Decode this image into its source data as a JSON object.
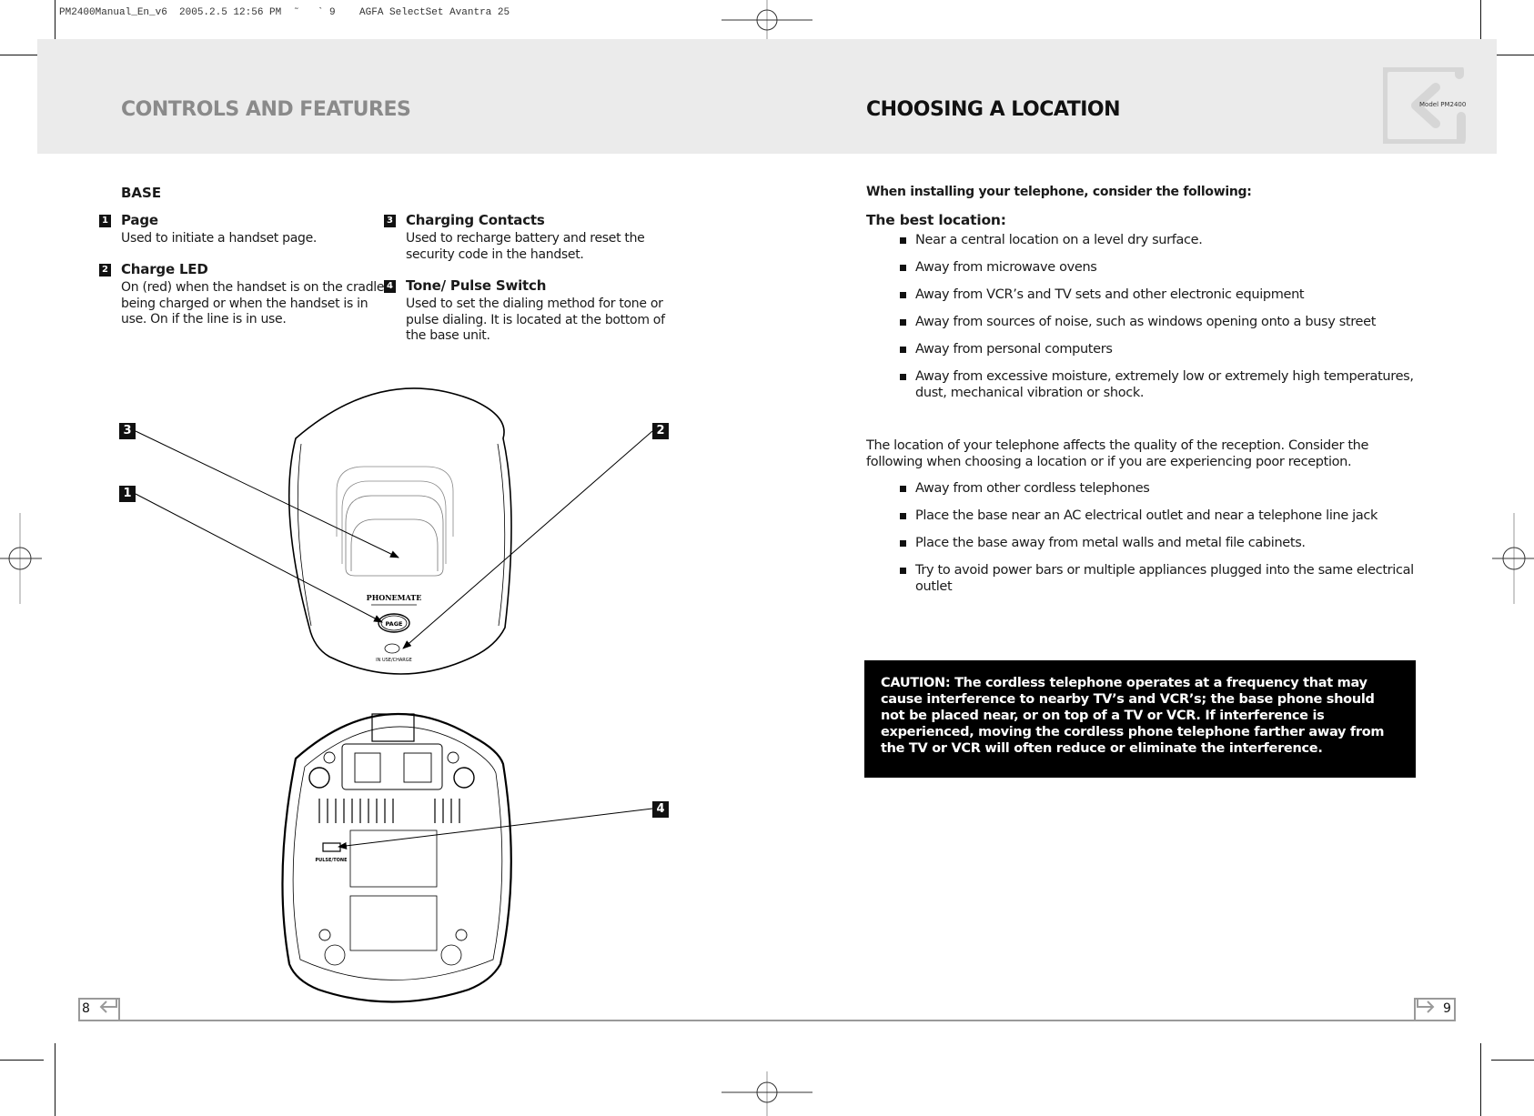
{
  "print_slug": "PM2400Manual_En_v6  2005.2.5 12:56 PM  ˜   ` 9    AGFA SelectSet Avantra 25",
  "header": {
    "left_title": "CONTROLS AND FEATURES",
    "right_title": "CHOOSING A LOCATION",
    "model_label": "Model PM2400"
  },
  "left_page": {
    "section_heading": "BASE",
    "features": [
      {
        "number": "1",
        "title": "Page",
        "description": "Used to initiate a handset page."
      },
      {
        "number": "2",
        "title": "Charge LED",
        "description": "On (red) when the handset is on the cradle being charged or when the handset is in use. On if the line is in use."
      },
      {
        "number": "3",
        "title": "Charging Contacts",
        "description": "Used to recharge battery and reset the security code in the handset."
      },
      {
        "number": "4",
        "title": "Tone/ Pulse Switch",
        "description": "Used to set the dialing method for tone or pulse dialing. It is located at the bottom of the base unit."
      }
    ],
    "diagram": {
      "callouts": [
        "3",
        "1",
        "2",
        "4"
      ],
      "top_view_labels": {
        "brand": "PHONEMATE",
        "page_button": "PAGE",
        "led_label": "IN USE/CHARGE"
      },
      "bottom_view_labels": {
        "switch_label": "PULSE/TONE"
      }
    },
    "page_number": "8"
  },
  "right_page": {
    "intro": "When installing your telephone, consider the following:",
    "best_location_heading": "The best location:",
    "best_location_items": [
      "Near a central location on a level dry surface.",
      "Away from microwave ovens",
      "Away from VCR’s and TV sets and other electronic equipment",
      "Away from sources of noise, such as windows opening onto a busy street",
      "Away from personal computers",
      "Away from excessive moisture, extremely low or extremely high temperatures, dust, mechanical vibration or shock."
    ],
    "reception_paragraph": "The location of your telephone affects the quality of the reception. Consider the following when choosing a location or if you are experiencing poor reception.",
    "reception_items": [
      "Away from other cordless telephones",
      "Place the base near an AC electrical outlet and near a telephone line jack",
      "Place the base away from metal walls and metal file cabinets.",
      "Try to avoid power bars or multiple appliances plugged into the same electrical outlet"
    ],
    "caution": {
      "label": "CAUTION:",
      "text": " The cordless telephone operates at a frequency that may cause interference to nearby TV’s and VCR’s; the base phone should not be placed near, or on top of a TV or VCR. If interference is experienced, moving the cordless phone telephone farther away from the TV or VCR will often reduce or eliminate the interference."
    },
    "page_number": "9"
  }
}
